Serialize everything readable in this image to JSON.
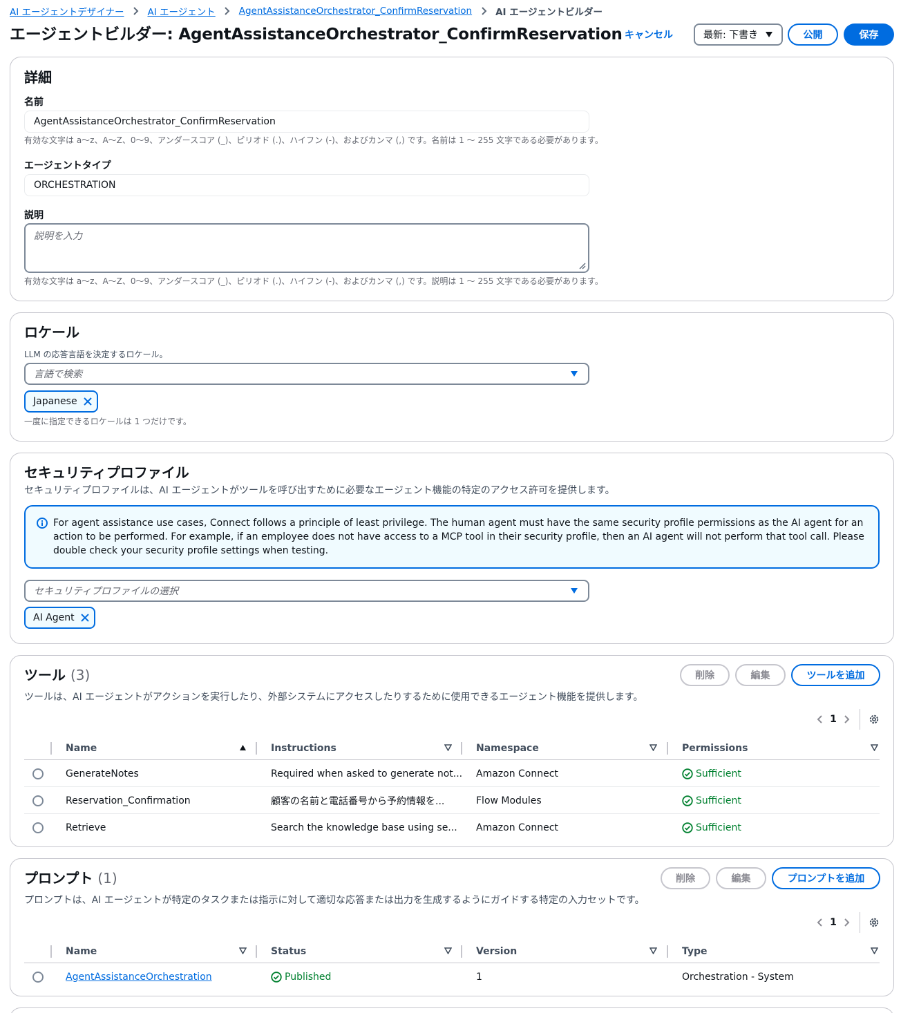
{
  "breadcrumb": {
    "items": [
      "AI エージェントデザイナー",
      "AI エージェント",
      "AgentAssistanceOrchestrator_ConfirmReservation"
    ],
    "current": "AI エージェントビルダー"
  },
  "header": {
    "title": "エージェントビルダー: AgentAssistanceOrchestrator_ConfirmReservation",
    "cancel_label": "キャンセル",
    "version_select": "最新: 下書き",
    "publish_label": "公開",
    "save_label": "保存"
  },
  "details": {
    "title": "詳細",
    "name_label": "名前",
    "name_value": "AgentAssistanceOrchestrator_ConfirmReservation",
    "name_hint": "有効な文字は a〜z、A〜Z、0〜9、アンダースコア (_)、ピリオド (.)、ハイフン (-)、およびカンマ (,) です。名前は 1 〜 255 文字である必要があります。",
    "type_label": "エージェントタイプ",
    "type_value": "ORCHESTRATION",
    "desc_label": "説明",
    "desc_placeholder": "説明を入力",
    "desc_hint": "有効な文字は a〜z、A〜Z、0〜9、アンダースコア (_)、ピリオド (.)、ハイフン (-)、およびカンマ (,) です。説明は 1 〜 255 文字である必要があります。"
  },
  "locale": {
    "title": "ロケール",
    "description": "LLM の応答言語を決定するロケール。",
    "search_placeholder": "言語で検索",
    "token": "Japanese",
    "hint": "一度に指定できるロケールは 1 つだけです。"
  },
  "security": {
    "title": "セキュリティプロファイル",
    "description": "セキュリティプロファイルは、AI エージェントがツールを呼び出すために必要なエージェント機能の特定のアクセス許可を提供します。",
    "info_text": "For agent assistance use cases, Connect follows a principle of least privilege. The human agent must have the same security profile permissions as the AI agent for an action to be performed. For example, if an employee does not have access to a MCP tool in their security profile, then an AI agent will not perform that tool call. Please double check your security profile settings when testing.",
    "select_placeholder": "セキュリティプロファイルの選択",
    "token": "AI Agent"
  },
  "tools": {
    "title": "ツール",
    "count": "(3)",
    "description": "ツールは、AI エージェントがアクションを実行したり、外部システムにアクセスしたりするために使用できるエージェント機能を提供します。",
    "delete_label": "削除",
    "edit_label": "編集",
    "add_label": "ツールを追加",
    "page": "1",
    "columns": [
      "Name",
      "Instructions",
      "Namespace",
      "Permissions"
    ],
    "rows": [
      {
        "name": "GenerateNotes",
        "instructions": "Required when asked to generate not...",
        "namespace": "Amazon Connect",
        "permissions": "Sufficient"
      },
      {
        "name": "Reservation_Confirmation",
        "instructions": "顧客の名前と電話番号から予約情報を...",
        "namespace": "Flow Modules",
        "permissions": "Sufficient"
      },
      {
        "name": "Retrieve",
        "instructions": "Search the knowledge base using se...",
        "namespace": "Amazon Connect",
        "permissions": "Sufficient"
      }
    ]
  },
  "prompts": {
    "title": "プロンプト",
    "count": "(1)",
    "description": "プロンプトは、AI エージェントが特定のタスクまたは指示に対して適切な応答または出力を生成するようにガイドする特定の入力セットです。",
    "delete_label": "削除",
    "edit_label": "編集",
    "add_label": "プロンプトを追加",
    "page": "1",
    "columns": [
      "Name",
      "Status",
      "Version",
      "Type"
    ],
    "rows": [
      {
        "name": "AgentAssistanceOrchestration",
        "status": "Published",
        "version": "1",
        "type": "Orchestration - System"
      }
    ]
  },
  "colors": {
    "accent": "#006ce0",
    "success": "#00802f",
    "border": "#c6c6cd",
    "info_bg": "#f0fbff"
  },
  "icons": [
    "chevron-right-icon",
    "caret-down-icon",
    "close-icon",
    "info-icon",
    "resize-icon",
    "chevron-left-icon",
    "settings-icon",
    "sort-ascending-icon",
    "sort-icon",
    "check-circle-icon"
  ]
}
